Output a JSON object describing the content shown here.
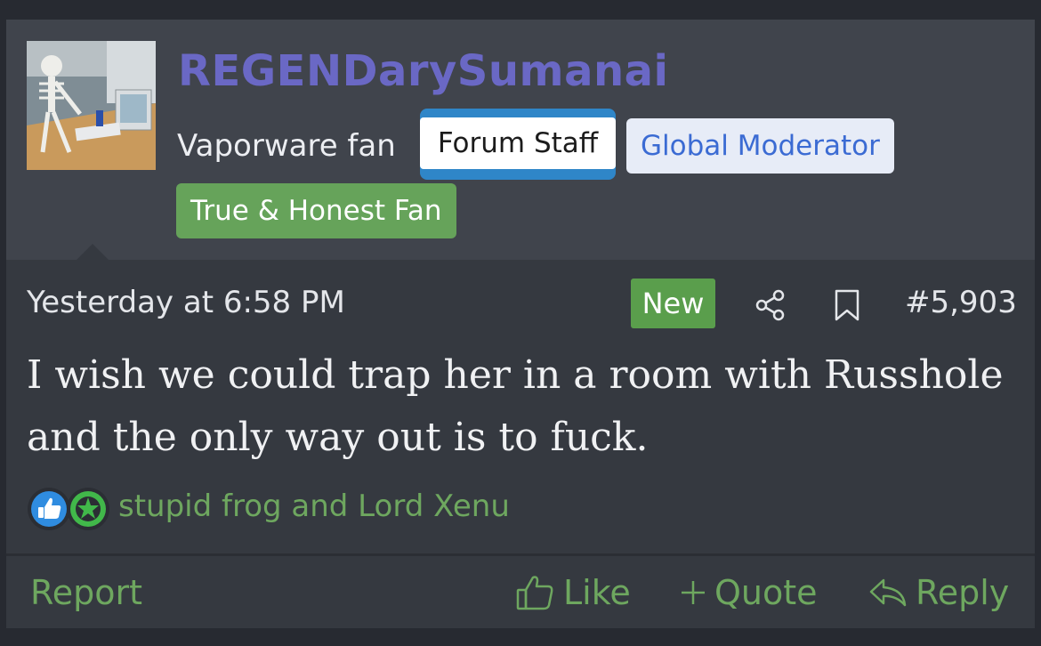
{
  "user": {
    "username": "REGENDarySumanai",
    "title": "Vaporware fan",
    "badges": {
      "staff": "Forum Staff",
      "moderator": "Global Moderator",
      "fan": "True & Honest Fan"
    },
    "avatar_icon": "skeleton-at-desk-avatar"
  },
  "post": {
    "timestamp": "Yesterday at 6:58 PM",
    "new_label": "New",
    "post_number": "#5,903",
    "message": "I wish we could trap her in a room with Russhole and the only way out is to fuck.",
    "icons": [
      "share-icon",
      "bookmark-icon"
    ]
  },
  "reactions": {
    "icons": [
      "like-reaction-icon",
      "star-reaction-icon"
    ],
    "users_text": "stupid frog and Lord Xenu"
  },
  "footer": {
    "report_label": "Report",
    "like_label": "Like",
    "quote_label": "Quote",
    "reply_label": "Reply"
  },
  "colors": {
    "page_bg": "#272a31",
    "post_bg": "#353940",
    "user_block_bg": "#40444c",
    "username": "#6a68c5",
    "accent_green": "#6ea75f",
    "staff_badge_border": "#2f86c8",
    "moderator_text": "#3b6bd3"
  }
}
